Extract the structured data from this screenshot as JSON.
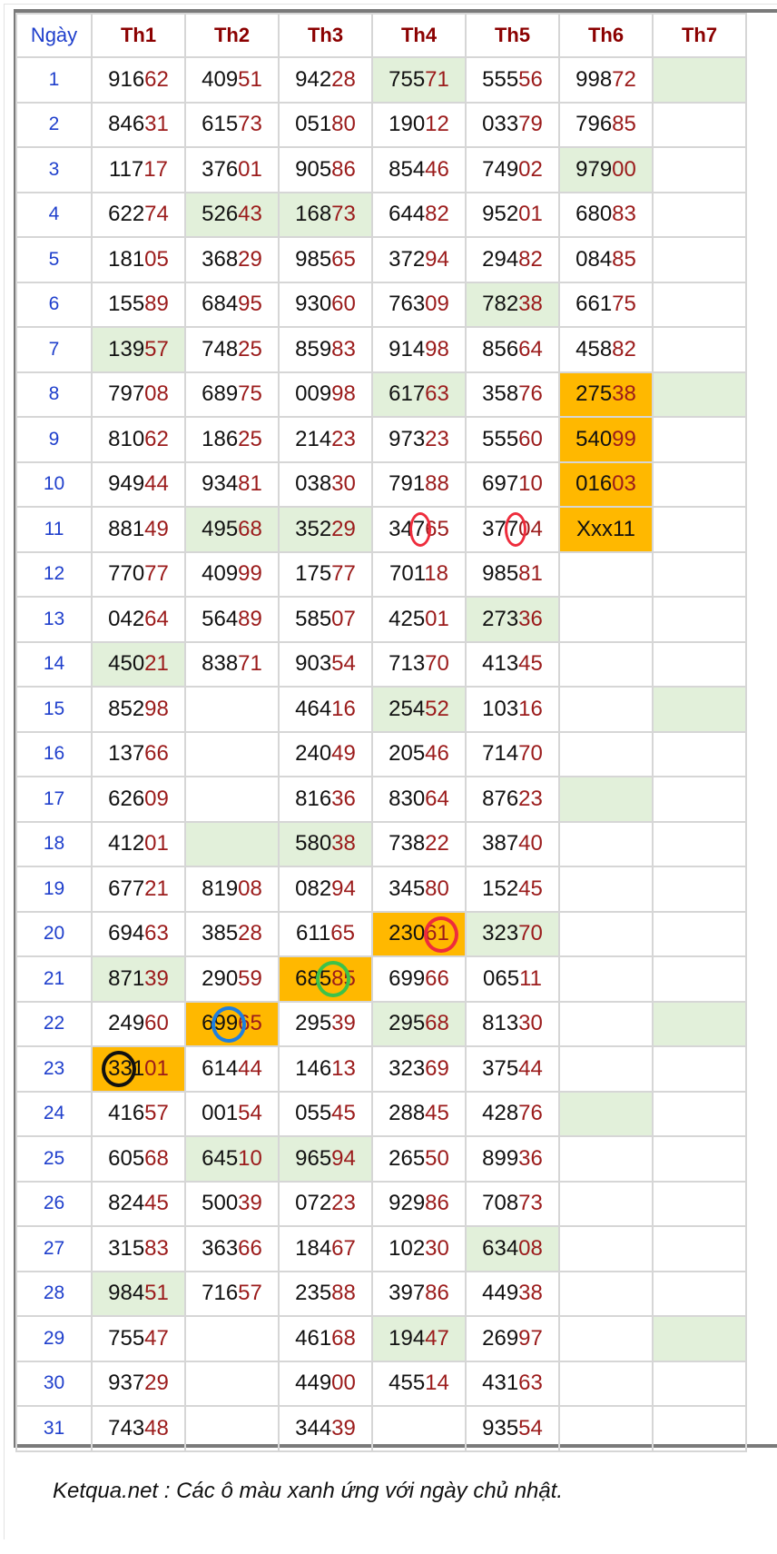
{
  "table": {
    "headers": [
      "Ngày",
      "Th1",
      "Th2",
      "Th3",
      "Th4",
      "Th5",
      "Th6",
      "Th7"
    ],
    "rows": [
      {
        "day": "1",
        "cells": [
          {
            "v": "91662"
          },
          {
            "v": "40951"
          },
          {
            "v": "94228"
          },
          {
            "v": "75571",
            "bg": "green"
          },
          {
            "v": "55556"
          },
          {
            "v": "99872"
          },
          {
            "v": "",
            "bg": "green"
          }
        ]
      },
      {
        "day": "2",
        "cells": [
          {
            "v": "84631"
          },
          {
            "v": "61573"
          },
          {
            "v": "05180"
          },
          {
            "v": "19012"
          },
          {
            "v": "03379"
          },
          {
            "v": "79685"
          },
          {
            "v": ""
          }
        ]
      },
      {
        "day": "3",
        "cells": [
          {
            "v": "11717"
          },
          {
            "v": "37601"
          },
          {
            "v": "90586"
          },
          {
            "v": "85446"
          },
          {
            "v": "74902"
          },
          {
            "v": "97900",
            "bg": "green"
          },
          {
            "v": ""
          }
        ]
      },
      {
        "day": "4",
        "cells": [
          {
            "v": "62274"
          },
          {
            "v": "52643",
            "bg": "green"
          },
          {
            "v": "16873",
            "bg": "green"
          },
          {
            "v": "64482"
          },
          {
            "v": "95201"
          },
          {
            "v": "68083"
          },
          {
            "v": ""
          }
        ]
      },
      {
        "day": "5",
        "cells": [
          {
            "v": "18105"
          },
          {
            "v": "36829"
          },
          {
            "v": "98565"
          },
          {
            "v": "37294"
          },
          {
            "v": "29482"
          },
          {
            "v": "08485"
          },
          {
            "v": ""
          }
        ]
      },
      {
        "day": "6",
        "cells": [
          {
            "v": "15589"
          },
          {
            "v": "68495"
          },
          {
            "v": "93060"
          },
          {
            "v": "76309"
          },
          {
            "v": "78238",
            "bg": "green"
          },
          {
            "v": "66175"
          },
          {
            "v": ""
          }
        ]
      },
      {
        "day": "7",
        "cells": [
          {
            "v": "13957",
            "bg": "green"
          },
          {
            "v": "74825"
          },
          {
            "v": "85983"
          },
          {
            "v": "91498"
          },
          {
            "v": "85664"
          },
          {
            "v": "45882"
          },
          {
            "v": ""
          }
        ]
      },
      {
        "day": "8",
        "cells": [
          {
            "v": "79708"
          },
          {
            "v": "68975"
          },
          {
            "v": "00998"
          },
          {
            "v": "61763",
            "bg": "green"
          },
          {
            "v": "35876"
          },
          {
            "v": "27538",
            "bg": "orange"
          },
          {
            "v": "",
            "bg": "green"
          }
        ]
      },
      {
        "day": "9",
        "cells": [
          {
            "v": "81062"
          },
          {
            "v": "18625"
          },
          {
            "v": "21423"
          },
          {
            "v": "97323"
          },
          {
            "v": "55560"
          },
          {
            "v": "54099",
            "bg": "orange"
          },
          {
            "v": ""
          }
        ]
      },
      {
        "day": "10",
        "cells": [
          {
            "v": "94944"
          },
          {
            "v": "93481"
          },
          {
            "v": "03830"
          },
          {
            "v": "79188"
          },
          {
            "v": "69710"
          },
          {
            "v": "01603",
            "bg": "orange"
          },
          {
            "v": ""
          }
        ]
      },
      {
        "day": "11",
        "cells": [
          {
            "v": "88149"
          },
          {
            "v": "49568",
            "bg": "green"
          },
          {
            "v": "35229",
            "bg": "green"
          },
          {
            "v": "34765"
          },
          {
            "v": "37704"
          },
          {
            "v": "Xxx11",
            "bg": "orange",
            "plain": true
          },
          {
            "v": ""
          }
        ]
      },
      {
        "day": "12",
        "cells": [
          {
            "v": "77077"
          },
          {
            "v": "40999"
          },
          {
            "v": "17577"
          },
          {
            "v": "70118"
          },
          {
            "v": "98581"
          },
          {
            "v": ""
          },
          {
            "v": ""
          }
        ]
      },
      {
        "day": "13",
        "cells": [
          {
            "v": "04264"
          },
          {
            "v": "56489"
          },
          {
            "v": "58507"
          },
          {
            "v": "42501"
          },
          {
            "v": "27336",
            "bg": "green"
          },
          {
            "v": ""
          },
          {
            "v": ""
          }
        ]
      },
      {
        "day": "14",
        "cells": [
          {
            "v": "45021",
            "bg": "green"
          },
          {
            "v": "83871"
          },
          {
            "v": "90354"
          },
          {
            "v": "71370"
          },
          {
            "v": "41345"
          },
          {
            "v": ""
          },
          {
            "v": ""
          }
        ]
      },
      {
        "day": "15",
        "cells": [
          {
            "v": "85298"
          },
          {
            "v": ""
          },
          {
            "v": "46416"
          },
          {
            "v": "25452",
            "bg": "green"
          },
          {
            "v": "10316"
          },
          {
            "v": ""
          },
          {
            "v": "",
            "bg": "green"
          }
        ]
      },
      {
        "day": "16",
        "cells": [
          {
            "v": "13766"
          },
          {
            "v": ""
          },
          {
            "v": "24049"
          },
          {
            "v": "20546"
          },
          {
            "v": "71470"
          },
          {
            "v": ""
          },
          {
            "v": ""
          }
        ]
      },
      {
        "day": "17",
        "cells": [
          {
            "v": "62609"
          },
          {
            "v": ""
          },
          {
            "v": "81636"
          },
          {
            "v": "83064"
          },
          {
            "v": "87623"
          },
          {
            "v": "",
            "bg": "green"
          },
          {
            "v": ""
          }
        ]
      },
      {
        "day": "18",
        "cells": [
          {
            "v": "41201"
          },
          {
            "v": "",
            "bg": "green"
          },
          {
            "v": "58038",
            "bg": "green"
          },
          {
            "v": "73822"
          },
          {
            "v": "38740"
          },
          {
            "v": ""
          },
          {
            "v": ""
          }
        ]
      },
      {
        "day": "19",
        "cells": [
          {
            "v": "67721"
          },
          {
            "v": "81908"
          },
          {
            "v": "08294"
          },
          {
            "v": "34580"
          },
          {
            "v": "15245"
          },
          {
            "v": ""
          },
          {
            "v": ""
          }
        ]
      },
      {
        "day": "20",
        "cells": [
          {
            "v": "69463"
          },
          {
            "v": "38528"
          },
          {
            "v": "61165"
          },
          {
            "v": "23061",
            "bg": "orange"
          },
          {
            "v": "32370",
            "bg": "green"
          },
          {
            "v": ""
          },
          {
            "v": ""
          }
        ]
      },
      {
        "day": "21",
        "cells": [
          {
            "v": "87139",
            "bg": "green"
          },
          {
            "v": "29059"
          },
          {
            "v": "68585",
            "bg": "orange"
          },
          {
            "v": "69966"
          },
          {
            "v": "06511"
          },
          {
            "v": ""
          },
          {
            "v": ""
          }
        ]
      },
      {
        "day": "22",
        "cells": [
          {
            "v": "24960"
          },
          {
            "v": "69965",
            "bg": "orange"
          },
          {
            "v": "29539"
          },
          {
            "v": "29568",
            "bg": "green"
          },
          {
            "v": "81330"
          },
          {
            "v": ""
          },
          {
            "v": "",
            "bg": "green"
          }
        ]
      },
      {
        "day": "23",
        "cells": [
          {
            "v": "33101",
            "bg": "orange"
          },
          {
            "v": "61444"
          },
          {
            "v": "14613"
          },
          {
            "v": "32369"
          },
          {
            "v": "37544"
          },
          {
            "v": ""
          },
          {
            "v": ""
          }
        ]
      },
      {
        "day": "24",
        "cells": [
          {
            "v": "41657"
          },
          {
            "v": "00154"
          },
          {
            "v": "05545"
          },
          {
            "v": "28845"
          },
          {
            "v": "42876"
          },
          {
            "v": "",
            "bg": "green"
          },
          {
            "v": ""
          }
        ]
      },
      {
        "day": "25",
        "cells": [
          {
            "v": "60568"
          },
          {
            "v": "64510",
            "bg": "green"
          },
          {
            "v": "96594",
            "bg": "green"
          },
          {
            "v": "26550"
          },
          {
            "v": "89936"
          },
          {
            "v": ""
          },
          {
            "v": ""
          }
        ]
      },
      {
        "day": "26",
        "cells": [
          {
            "v": "82445"
          },
          {
            "v": "50039"
          },
          {
            "v": "07223"
          },
          {
            "v": "92986"
          },
          {
            "v": "70873"
          },
          {
            "v": ""
          },
          {
            "v": ""
          }
        ]
      },
      {
        "day": "27",
        "cells": [
          {
            "v": "31583"
          },
          {
            "v": "36366"
          },
          {
            "v": "18467"
          },
          {
            "v": "10230"
          },
          {
            "v": "63408",
            "bg": "green"
          },
          {
            "v": ""
          },
          {
            "v": ""
          }
        ]
      },
      {
        "day": "28",
        "cells": [
          {
            "v": "98451",
            "bg": "green"
          },
          {
            "v": "71657"
          },
          {
            "v": "23588"
          },
          {
            "v": "39786"
          },
          {
            "v": "44938"
          },
          {
            "v": ""
          },
          {
            "v": ""
          }
        ]
      },
      {
        "day": "29",
        "cells": [
          {
            "v": "75547"
          },
          {
            "v": ""
          },
          {
            "v": "46168"
          },
          {
            "v": "19447",
            "bg": "green"
          },
          {
            "v": "26997"
          },
          {
            "v": ""
          },
          {
            "v": "",
            "bg": "green"
          }
        ]
      },
      {
        "day": "30",
        "cells": [
          {
            "v": "93729"
          },
          {
            "v": ""
          },
          {
            "v": "44900"
          },
          {
            "v": "45514"
          },
          {
            "v": "43163"
          },
          {
            "v": ""
          },
          {
            "v": ""
          }
        ]
      },
      {
        "day": "31",
        "cells": [
          {
            "v": "74348"
          },
          {
            "v": ""
          },
          {
            "v": "34439"
          },
          {
            "v": ""
          },
          {
            "v": "93554"
          },
          {
            "v": ""
          },
          {
            "v": ""
          }
        ]
      }
    ],
    "circle_marks": [
      {
        "row": 11,
        "col": 4,
        "color": "#ee2c3c",
        "shape": "small-oval"
      },
      {
        "row": 11,
        "col": 5,
        "color": "#ee2c3c",
        "shape": "small-oval"
      },
      {
        "row": 20,
        "col": 4,
        "color": "#ee2c3c",
        "shape": "circle"
      },
      {
        "row": 21,
        "col": 3,
        "color": "#3cc24a",
        "shape": "circle"
      },
      {
        "row": 22,
        "col": 2,
        "color": "#1e7fe0",
        "shape": "circle"
      },
      {
        "row": 23,
        "col": 1,
        "color": "#111111",
        "shape": "circle"
      }
    ]
  },
  "colors": {
    "green": "#e2f0da",
    "orange": "#ffb800",
    "day": "#1f3fcc",
    "header": "#8b0000",
    "tail": "#9b1b1b"
  },
  "footer": {
    "note": "Ketqua.net : Các ô màu xanh ứng với ngày chủ nhật."
  }
}
